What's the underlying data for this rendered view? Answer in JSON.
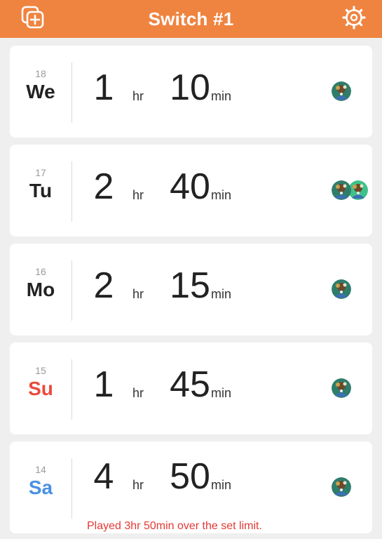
{
  "header": {
    "title": "Switch #1",
    "add_icon": "add-console-icon",
    "settings_icon": "gear-icon"
  },
  "colors": {
    "header": "#ef8440",
    "sunday": "#e84c3d",
    "saturday": "#4a90e2",
    "warning": "#e53935"
  },
  "units": {
    "hr": "hr",
    "min": "min"
  },
  "days": [
    {
      "date": "18",
      "day": "We",
      "hours": "1",
      "minutes": "10",
      "avatars": 1,
      "day_color": "#222222",
      "warning": ""
    },
    {
      "date": "17",
      "day": "Tu",
      "hours": "2",
      "minutes": "40",
      "avatars": 2,
      "day_color": "#222222",
      "warning": ""
    },
    {
      "date": "16",
      "day": "Mo",
      "hours": "2",
      "minutes": "15",
      "avatars": 1,
      "day_color": "#222222",
      "warning": ""
    },
    {
      "date": "15",
      "day": "Su",
      "hours": "1",
      "minutes": "45",
      "avatars": 1,
      "day_color": "#e84c3d",
      "warning": ""
    },
    {
      "date": "14",
      "day": "Sa",
      "hours": "4",
      "minutes": "50",
      "avatars": 1,
      "day_color": "#4a90e2",
      "warning": "Played 3hr 50min over the set limit."
    }
  ]
}
